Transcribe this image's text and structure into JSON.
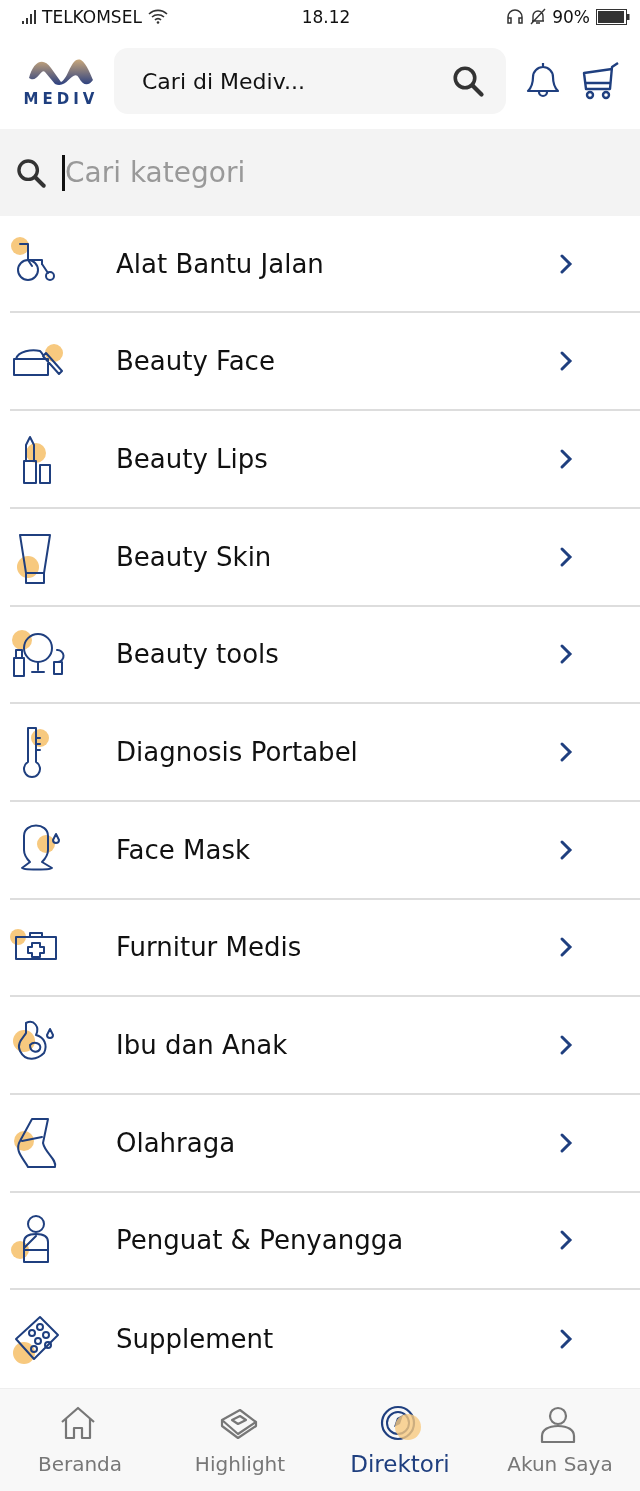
{
  "status_bar": {
    "carrier": "TELKOMSEL",
    "time": "18.12",
    "battery": "90%"
  },
  "header": {
    "logo": "MEDIV",
    "search": {
      "placeholder": "Cari di Mediv..."
    }
  },
  "category_search": {
    "placeholder": "Cari kategori"
  },
  "categories": [
    {
      "label": "Alat Bantu Jalan"
    },
    {
      "label": "Beauty Face"
    },
    {
      "label": "Beauty Lips"
    },
    {
      "label": "Beauty Skin"
    },
    {
      "label": "Beauty tools"
    },
    {
      "label": "Diagnosis Portabel"
    },
    {
      "label": "Face Mask"
    },
    {
      "label": "Furnitur Medis"
    },
    {
      "label": "Ibu dan Anak"
    },
    {
      "label": "Olahraga"
    },
    {
      "label": "Penguat & Penyangga"
    },
    {
      "label": "Supplement"
    }
  ],
  "bottom_nav": [
    {
      "label": "Beranda",
      "selected": false
    },
    {
      "label": "Highlight",
      "selected": false
    },
    {
      "label": "Direktori",
      "selected": true
    },
    {
      "label": "Akun Saya",
      "selected": false
    }
  ]
}
